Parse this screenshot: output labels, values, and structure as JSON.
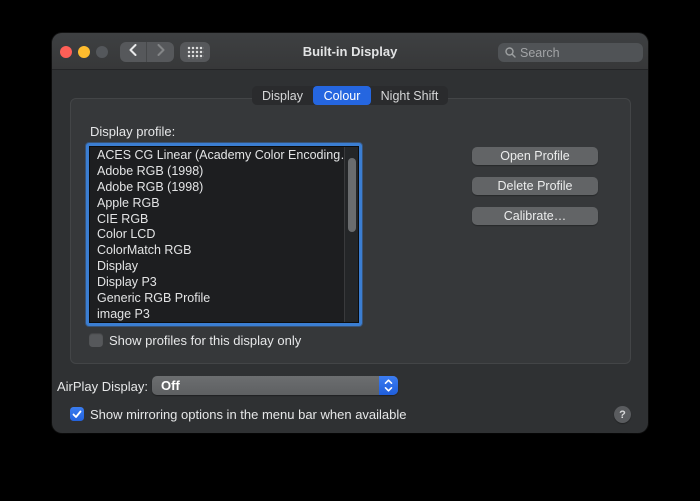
{
  "titlebar": {
    "title": "Built-in Display",
    "search": {
      "placeholder": "Search"
    }
  },
  "tabs": {
    "items": [
      {
        "label": "Display",
        "selected": false
      },
      {
        "label": "Colour",
        "selected": true
      },
      {
        "label": "Night Shift",
        "selected": false
      }
    ]
  },
  "profile_section": {
    "label": "Display profile:",
    "profiles": [
      "ACES CG Linear (Academy Color Encoding…",
      "Adobe RGB (1998)",
      "Adobe RGB (1998)",
      "Apple RGB",
      "CIE RGB",
      "Color LCD",
      "ColorMatch RGB",
      "Display",
      "Display P3",
      "Generic RGB Profile",
      "image P3"
    ],
    "show_only_checkbox": {
      "label": "Show profiles for this display only",
      "checked": false
    },
    "buttons": {
      "open": "Open Profile",
      "delete": "Delete Profile",
      "calibrate": "Calibrate…"
    }
  },
  "airplay": {
    "label": "AirPlay Display:",
    "value": "Off"
  },
  "mirroring_checkbox": {
    "label": "Show mirroring options in the menu bar when available",
    "checked": true
  },
  "help_button": {
    "label": "?"
  },
  "colors": {
    "accent_blue": "#2566e0",
    "focus_ring": "#3b7ed2",
    "traffic_red": "#ff5f57",
    "traffic_yellow": "#febc2e",
    "traffic_disabled": "#54575b",
    "titlebar": "#3b3d3f",
    "window_body": "#2f3133",
    "list_background": "#1d1e20"
  }
}
